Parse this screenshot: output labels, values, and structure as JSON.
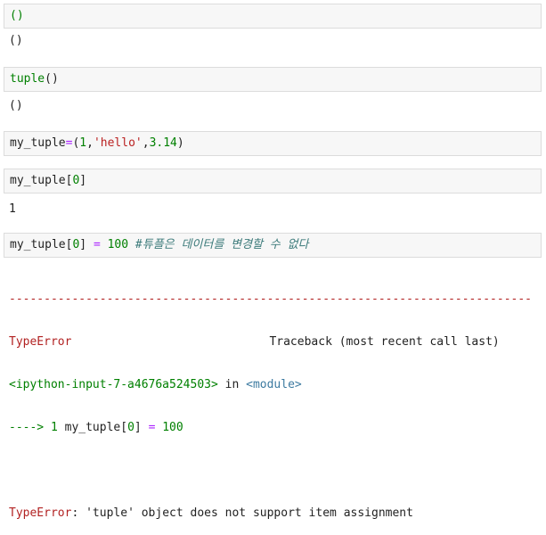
{
  "cells": [
    {
      "input_tokens": [
        {
          "t": "()",
          "c": "green"
        }
      ],
      "output": "()"
    },
    {
      "input_tokens": [
        {
          "t": "tuple",
          "c": "green"
        },
        {
          "t": "()",
          "c": "default"
        }
      ],
      "output": "()"
    },
    {
      "input_tokens": [
        {
          "t": "my_tuple",
          "c": "default"
        },
        {
          "t": "=",
          "c": "op"
        },
        {
          "t": "(",
          "c": "default"
        },
        {
          "t": "1",
          "c": "num"
        },
        {
          "t": ",",
          "c": "default"
        },
        {
          "t": "'hello'",
          "c": "str"
        },
        {
          "t": ",",
          "c": "default"
        },
        {
          "t": "3.14",
          "c": "num"
        },
        {
          "t": ")",
          "c": "default"
        }
      ],
      "output": ""
    },
    {
      "input_tokens": [
        {
          "t": "my_tuple[",
          "c": "default"
        },
        {
          "t": "0",
          "c": "num"
        },
        {
          "t": "]",
          "c": "default"
        }
      ],
      "output": "1"
    },
    {
      "input_tokens": [
        {
          "t": "my_tuple[",
          "c": "default"
        },
        {
          "t": "0",
          "c": "num"
        },
        {
          "t": "] ",
          "c": "default"
        },
        {
          "t": "=",
          "c": "op"
        },
        {
          "t": " ",
          "c": "default"
        },
        {
          "t": "100",
          "c": "num"
        },
        {
          "t": " #튜플은 데이터를 변경할 수 없다",
          "c": "comment"
        }
      ],
      "output": ""
    }
  ],
  "traceback": {
    "dashes": "---------------------------------------------------------------------------",
    "error_type": "TypeError",
    "traceback_label": "Traceback (most recent call last)",
    "input_ref": "<ipython-input-7-a4676a524503>",
    "in_word": " in ",
    "module": "<module>",
    "arrow_line_prefix": "----> 1 ",
    "arrow_line_code_a": "my_tuple[",
    "arrow_line_code_num": "0",
    "arrow_line_code_b": "] ",
    "arrow_line_eq": "=",
    "arrow_line_value": " 100",
    "final_error_type": "TypeError",
    "final_message": ": 'tuple' object does not support item assignment"
  }
}
